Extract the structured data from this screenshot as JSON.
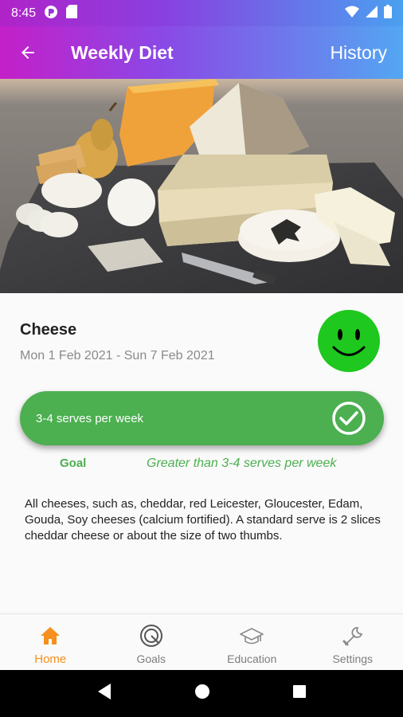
{
  "status": {
    "time": "8:45"
  },
  "header": {
    "title": "Weekly Diet",
    "history_label": "History"
  },
  "food": {
    "name": "Cheese",
    "date_range": "Mon 1 Feb 2021 - Sun 7 Feb 2021",
    "serves": "3-4 serves per week",
    "goal_label": "Goal",
    "goal_value": "Greater than 3-4 serves per week",
    "description": "All cheeses, such as, cheddar, red Leicester, Gloucester, Edam, Gouda, Soy cheeses (calcium fortified). A standard serve is 2 slices cheddar cheese or about the size of two thumbs."
  },
  "bottom_nav": {
    "items": [
      {
        "label": "Home",
        "icon": "home-icon",
        "active": true
      },
      {
        "label": "Goals",
        "icon": "goals-icon",
        "active": false
      },
      {
        "label": "Education",
        "icon": "education-icon",
        "active": false
      },
      {
        "label": "Settings",
        "icon": "settings-icon",
        "active": false
      }
    ]
  },
  "colors": {
    "accent_green": "#4caf50",
    "smiley_green": "#1ec81e",
    "nav_active": "#f5901e",
    "nav_inactive": "#7d7d7d"
  }
}
